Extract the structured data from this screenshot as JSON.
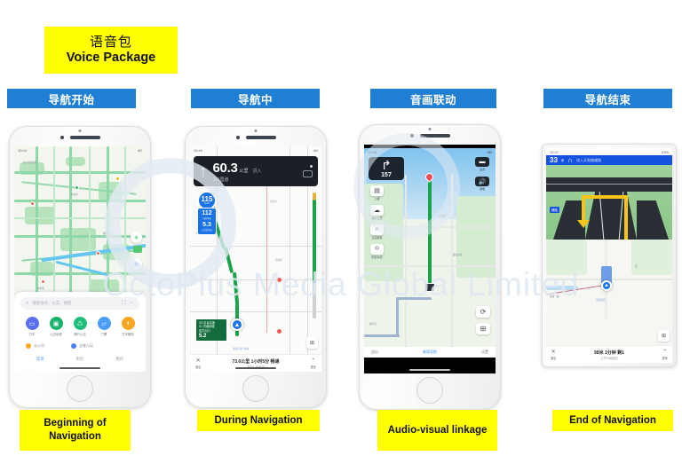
{
  "title": {
    "cn": "语音包",
    "en": "Voice Package"
  },
  "chips": [
    {
      "label": "导航开始"
    },
    {
      "label": "导航中"
    },
    {
      "label": "音画联动"
    },
    {
      "label": "导航结束"
    }
  ],
  "captions": [
    {
      "text": "Beginning of Navigation"
    },
    {
      "text": "During Navigation"
    },
    {
      "text": "Audio-visual linkage"
    },
    {
      "text": "End of Navigation"
    }
  ],
  "watermark": "OctoPlus Media Global Limited",
  "colors": {
    "chip_blue": "#1e7fd4",
    "caption_yellow": "#ffff00",
    "route_green": "#1aa34a",
    "nav_blue": "#1452e0",
    "lane_yellow": "#f5c518"
  },
  "phone1": {
    "status_time": "10:04",
    "status_right": "4G",
    "search_placeholder": "搜索地点、公交、地铁",
    "search_icon": "search-icon",
    "scan_icon": "scan-icon",
    "voice_icon": "voice-icon",
    "quick_actions": [
      {
        "label": "打车",
        "icon": "taxi-icon",
        "color": "#5b6ff5"
      },
      {
        "label": "公交地铁",
        "icon": "bus-icon",
        "color": "#17b36a"
      },
      {
        "label": "骑行公交",
        "icon": "bike-icon",
        "color": "#1cc07a"
      },
      {
        "label": "门票",
        "icon": "ticket-icon",
        "color": "#4a9df8"
      },
      {
        "label": "打车服务",
        "icon": "car-service-icon",
        "color": "#f6a623"
      }
    ],
    "shortcuts": [
      {
        "label": "去公司",
        "color": "#f6a623"
      },
      {
        "label": "去哪儿玩",
        "color": "#4a7df8"
      }
    ],
    "tabs": [
      {
        "label": "首页",
        "active": true
      },
      {
        "label": "附近",
        "active": false
      },
      {
        "label": "我的",
        "active": false
      }
    ]
  },
  "phone2": {
    "status_time": "10:44",
    "status_right": "4G",
    "banner": {
      "arrow_icon": "straight-arrow-icon",
      "distance": "60.3",
      "unit": "公里",
      "action": "进入",
      "road": "311国道"
    },
    "speed_sign": {
      "limit_value": "115",
      "limit_unit": "km/h",
      "current_value": "112",
      "current_unit": "当前车速",
      "remaining_value": "5.3",
      "remaining_unit": "公里后到达"
    },
    "green_sign": {
      "line1": "G3 京台高速",
      "line2": "S1 济南绕城",
      "line3": "前方出口",
      "distance": "5.2",
      "distance_unit": "公里"
    },
    "bottom": {
      "left_icon": "close-icon",
      "left_label": "退出",
      "summary": "73.6公里 1小时5分 畅通",
      "eta": "下午1:48到达",
      "right_icon": "chevron-up-icon",
      "right_label": "更多"
    }
  },
  "phone3": {
    "status_time": "10:48",
    "status_right": "4G",
    "turn_card": {
      "arrow_icon": "turn-right-icon",
      "distance": "157",
      "unit": "米"
    },
    "left_buttons": [
      {
        "label": "上报",
        "icon": "report-icon"
      },
      {
        "label": "偏好设置",
        "icon": "settings-icon"
      },
      {
        "label": "沿途搜索",
        "icon": "search-icon"
      },
      {
        "label": "附近车况",
        "icon": "traffic-icon"
      }
    ],
    "right_buttons": [
      {
        "label": "全览",
        "icon": "overview-icon"
      },
      {
        "label": "音量",
        "icon": "speaker-icon"
      }
    ],
    "right_buttons2": [
      {
        "label": "",
        "icon": "refresh-icon"
      },
      {
        "label": "更多",
        "icon": "grid-icon"
      }
    ],
    "bottom": {
      "left": "退出",
      "center": "继续导航",
      "right": "设置"
    }
  },
  "phone4": {
    "status_time": "10:47",
    "status_right": "53%",
    "header": {
      "distance": "33",
      "unit": "米",
      "maneuver_icon": "u-turn-icon",
      "road": "进入天和路辅路"
    },
    "junction_label": "辅路",
    "camera_badge": "0",
    "map_label": "香园小区",
    "destination_label": "天和佳园",
    "bottom": {
      "left_icon": "close-icon",
      "left_label": "退出",
      "summary": "98米 1分钟 剩1",
      "eta": "上午9:48到达",
      "right_icon": "chevron-up-icon",
      "right_label": "更多"
    }
  }
}
